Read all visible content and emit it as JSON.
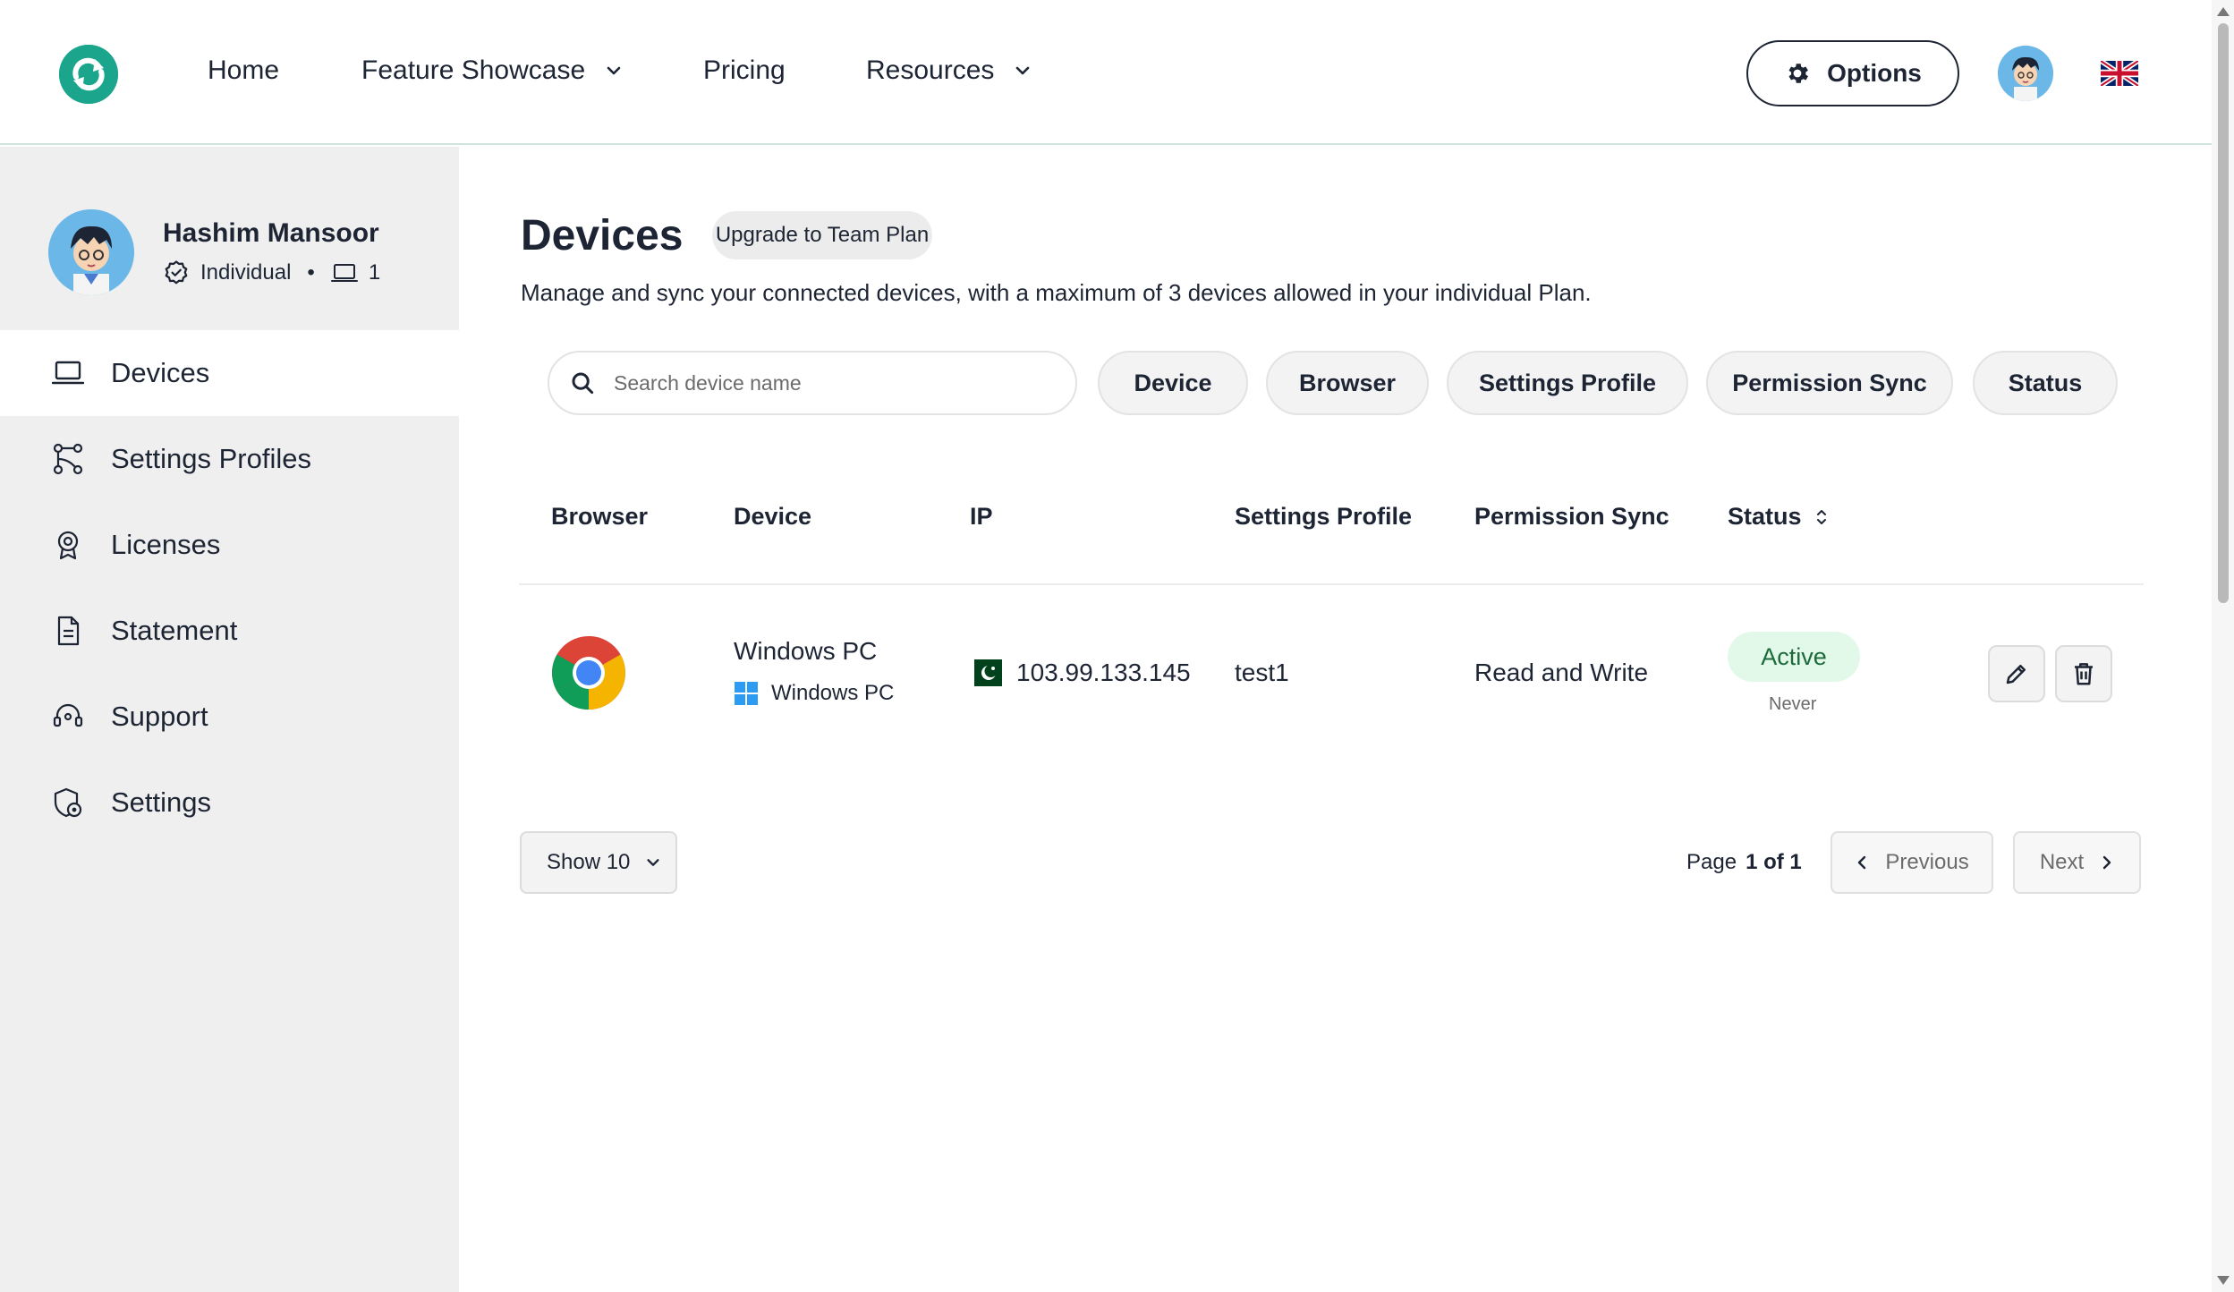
{
  "nav": {
    "items": [
      {
        "label": "Home",
        "has_dropdown": false
      },
      {
        "label": "Feature Showcase",
        "has_dropdown": true
      },
      {
        "label": "Pricing",
        "has_dropdown": false
      },
      {
        "label": "Resources",
        "has_dropdown": true
      }
    ],
    "options_label": "Options",
    "language_flag": "uk-flag-icon",
    "brand_color": "#1aa58c"
  },
  "profile": {
    "name": "Hashim Mansoor",
    "plan": "Individual",
    "separator": "•",
    "device_count": "1"
  },
  "sidebar": {
    "items": [
      {
        "label": "Devices",
        "icon": "laptop-icon",
        "active": true
      },
      {
        "label": "Settings Profiles",
        "icon": "profiles-icon",
        "active": false
      },
      {
        "label": "Licenses",
        "icon": "license-icon",
        "active": false
      },
      {
        "label": "Statement",
        "icon": "document-icon",
        "active": false
      },
      {
        "label": "Support",
        "icon": "headset-icon",
        "active": false
      },
      {
        "label": "Settings",
        "icon": "settings-shield-icon",
        "active": false
      }
    ]
  },
  "main": {
    "title": "Devices",
    "upgrade_label": "Upgrade to Team Plan",
    "subtitle": "Manage and sync your connected devices, with a maximum of 3 devices allowed in your individual Plan.",
    "search_placeholder": "Search device name",
    "filters": [
      "Device",
      "Browser",
      "Settings Profile",
      "Permission Sync",
      "Status"
    ],
    "columns": [
      "Browser",
      "Device",
      "IP",
      "Settings Profile",
      "Permission Sync",
      "Status"
    ],
    "rows": [
      {
        "browser_icon": "chrome-icon",
        "device_name": "Windows PC",
        "os_label": "Windows PC",
        "os_icon": "windows-icon",
        "country_flag": "pakistan-flag-icon",
        "ip": "103.99.133.145",
        "settings_profile": "test1",
        "permission_sync": "Read and Write",
        "status": "Active",
        "status_sub": "Never",
        "status_color": "#1d6b3b"
      }
    ],
    "page_size_label": "Show 10",
    "page_label": "Page",
    "page_value": "1 of 1",
    "previous_label": "Previous",
    "next_label": "Next"
  }
}
